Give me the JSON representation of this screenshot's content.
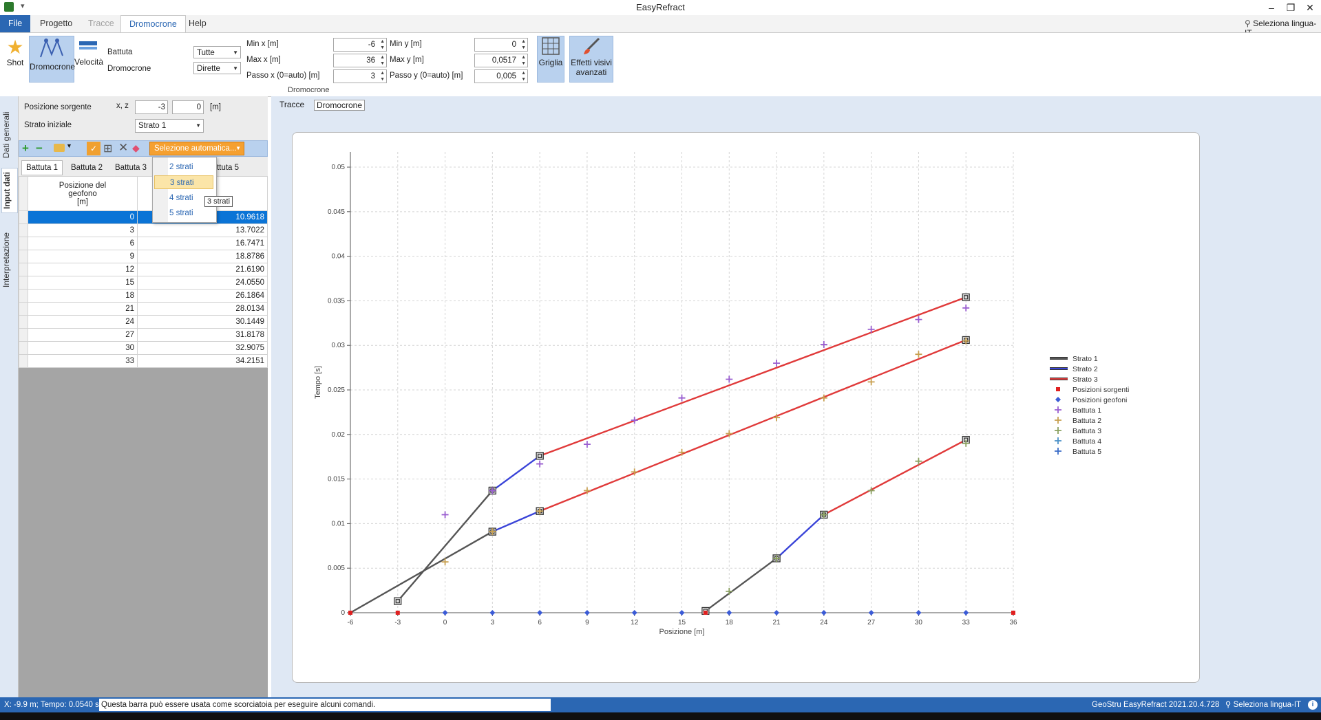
{
  "app": {
    "title": "EasyRefract"
  },
  "window_controls": {
    "minimize": "–",
    "restore": "❐",
    "close": "✕"
  },
  "ribbon_tabs": [
    {
      "label": "File"
    },
    {
      "label": "Progetto"
    },
    {
      "label": "Tracce"
    },
    {
      "label": "Dromocrone"
    },
    {
      "label": "Help"
    }
  ],
  "language_top": "Seleziona lingua-IT",
  "ribbon": {
    "shot_label": "Shot",
    "dromocrone_label": "Dromocrone",
    "velocita_label": "Velocità",
    "battuta_label": "Battuta",
    "battuta_value": "Tutte",
    "dromocrone_combo_label": "Dromocrone",
    "dromocrone_value": "Dirette",
    "min_x_label": "Min x [m]",
    "min_x": "-6",
    "max_x_label": "Max x [m]",
    "max_x": "36",
    "passo_x_label": "Passo x (0=auto) [m]",
    "passo_x": "3",
    "min_y_label": "Min y [m]",
    "min_y": "0",
    "max_y_label": "Max y [m]",
    "max_y": "0,0517",
    "passo_y_label": "Passo y (0=auto) [m]",
    "passo_y": "0,005",
    "group_label": "Dromocrone",
    "griglia_label": "Griglia",
    "effetti_label_1": "Effetti visivi",
    "effetti_label_2": "avanzati"
  },
  "side_tabs": [
    {
      "label": "Dati generali"
    },
    {
      "label": "Input dati"
    },
    {
      "label": "Interpretazione"
    }
  ],
  "left": {
    "posizione_label": "Posizione sorgente",
    "xz_label": "x, z",
    "x_value": "-3",
    "z_value": "0",
    "unit": "[m]",
    "strato_label": "Strato iniziale",
    "strato_value": "Strato 1",
    "auto_select": "Selezione automatica...",
    "battute": [
      {
        "label": "Battuta 1"
      },
      {
        "label": "Battuta 2"
      },
      {
        "label": "Battuta 3"
      },
      {
        "label": "Battuta 5"
      }
    ],
    "dropdown_items": [
      {
        "label": "2 strati"
      },
      {
        "label": "3 strati"
      },
      {
        "label": "4 strati"
      },
      {
        "label": "5 strati"
      }
    ],
    "tooltip": "3 strati",
    "col_header_1": "Posizione del",
    "col_header_2": "geofono",
    "col_header_3": "[m]",
    "rows": [
      {
        "pos": "0",
        "val": "10.9618"
      },
      {
        "pos": "3",
        "val": "13.7022"
      },
      {
        "pos": "6",
        "val": "16.7471"
      },
      {
        "pos": "9",
        "val": "18.8786"
      },
      {
        "pos": "12",
        "val": "21.6190"
      },
      {
        "pos": "15",
        "val": "24.0550"
      },
      {
        "pos": "18",
        "val": "26.1864"
      },
      {
        "pos": "21",
        "val": "28.0134"
      },
      {
        "pos": "24",
        "val": "30.1449"
      },
      {
        "pos": "27",
        "val": "31.8178"
      },
      {
        "pos": "30",
        "val": "32.9075"
      },
      {
        "pos": "33",
        "val": "34.2151"
      }
    ]
  },
  "workspace_tabs": [
    {
      "label": "Tracce"
    },
    {
      "label": "Dromocrone"
    }
  ],
  "status": {
    "coords": "X: -9.9 m; Tempo: 0.0540 s",
    "hint": "Questa barra può essere usata come scorciatoia per eseguire alcuni comandi.",
    "version": "GeoStru EasyRefract 2021.20.4.728",
    "language": "Seleziona lingua-IT"
  },
  "colors": {
    "accent": "#2b67b3",
    "strato1": "#555555",
    "strato2": "#3a44d8",
    "strato3": "#e03a3a",
    "battuta1": "#9a5fd0",
    "battuta2": "#c8a050",
    "battuta3": "#8aa060",
    "battuta4": "#4a90c8",
    "battuta5": "#3a6cc8",
    "sorgenti": "#e02020",
    "geofoni": "#3b5bd6"
  },
  "chart_data": {
    "type": "line",
    "xlabel": "Posizione [m]",
    "ylabel": "Tempo [s]",
    "xlim": [
      -6,
      36
    ],
    "ylim": [
      0,
      0.0517
    ],
    "xticks": [
      "-6",
      "-3",
      "0",
      "3",
      "6",
      "9",
      "12",
      "15",
      "18",
      "21",
      "24",
      "27",
      "30",
      "33",
      "36"
    ],
    "yticks": [
      "0",
      "0.005",
      "0.01",
      "0.015",
      "0.02",
      "0.025",
      "0.03",
      "0.035",
      "0.04",
      "0.045",
      "0.05"
    ],
    "grid": true,
    "legend_position": "right",
    "series": [
      {
        "name": "Strato 1",
        "segments": [
          {
            "x": [
              -6,
              3
            ],
            "y": [
              0,
              0.0091
            ]
          },
          {
            "x": [
              -3,
              3
            ],
            "y": [
              0.0013,
              0.0137
            ]
          },
          {
            "x": [
              16.5,
              21
            ],
            "y": [
              0.0002,
              0.0061
            ]
          }
        ]
      },
      {
        "name": "Strato 2",
        "segments": [
          {
            "x": [
              3,
              6
            ],
            "y": [
              0.0137,
              0.0176
            ]
          },
          {
            "x": [
              3,
              6
            ],
            "y": [
              0.0091,
              0.0114
            ]
          },
          {
            "x": [
              21,
              24
            ],
            "y": [
              0.0061,
              0.011
            ]
          }
        ]
      },
      {
        "name": "Strato 3",
        "segments": [
          {
            "x": [
              6,
              33
            ],
            "y": [
              0.0176,
              0.0354
            ]
          },
          {
            "x": [
              6,
              33
            ],
            "y": [
              0.0114,
              0.0306
            ]
          },
          {
            "x": [
              24,
              33
            ],
            "y": [
              0.011,
              0.0194
            ]
          }
        ]
      },
      {
        "name": "Posizioni sorgenti",
        "x": [
          -6,
          -3,
          16.5,
          36
        ],
        "y": [
          0,
          0,
          0,
          0
        ]
      },
      {
        "name": "Posizioni geofoni",
        "x": [
          0,
          3,
          6,
          9,
          12,
          15,
          18,
          21,
          24,
          27,
          30,
          33
        ],
        "y": [
          0,
          0,
          0,
          0,
          0,
          0,
          0,
          0,
          0,
          0,
          0,
          0
        ]
      },
      {
        "name": "Battuta 1",
        "x": [
          0,
          3,
          6,
          9,
          12,
          15,
          18,
          21,
          24,
          27,
          30,
          33
        ],
        "y": [
          0.011,
          0.0137,
          0.0167,
          0.0189,
          0.0216,
          0.0241,
          0.0262,
          0.028,
          0.0301,
          0.0318,
          0.0329,
          0.0342
        ]
      },
      {
        "name": "Battuta 2",
        "x": [
          0,
          3,
          6,
          9,
          12,
          15,
          18,
          21,
          24,
          27,
          30,
          33
        ],
        "y": [
          0.0057,
          0.0091,
          0.0114,
          0.0137,
          0.0158,
          0.018,
          0.0201,
          0.0219,
          0.0241,
          0.0259,
          0.029,
          0.0305
        ]
      },
      {
        "name": "Battuta 3",
        "x": [
          18,
          21,
          24,
          27,
          30,
          33
        ],
        "y": [
          0.0024,
          0.0061,
          0.011,
          0.0137,
          0.017,
          0.019
        ]
      },
      {
        "name": "Battuta 4",
        "x": [],
        "y": []
      },
      {
        "name": "Battuta 5",
        "x": [],
        "y": []
      }
    ]
  }
}
